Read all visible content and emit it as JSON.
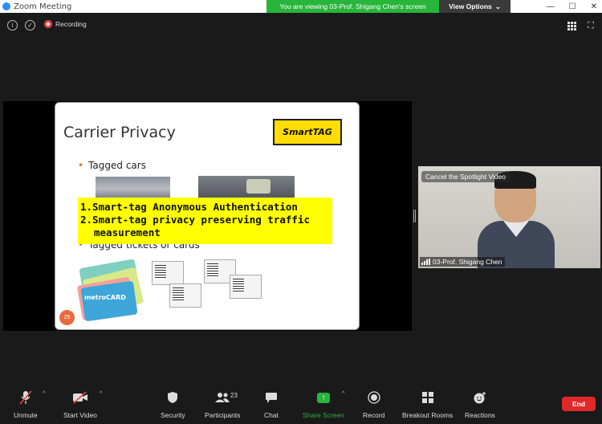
{
  "window": {
    "title": "Zoom Meeting",
    "minimize": "—",
    "maximize": "☐",
    "close": "✕"
  },
  "banner": {
    "message": "You are viewing 03-Prof. Shigang Chen's screen",
    "view_options": "View Options",
    "caret": "⌄"
  },
  "topbar": {
    "info_icon": "i",
    "shield_icon": "✓",
    "recording_label": "Recording",
    "fullscreen_icon": "⛶"
  },
  "slide": {
    "title": "Carrier Privacy",
    "logo_text": "SmartTAG",
    "bullet1": "Tagged cars",
    "bullet2": "Tagged tickets or cards",
    "callout_lines": [
      "1.Smart-tag Anonymous Authentication",
      "2.Smart-tag privacy preserving traffic",
      "measurement"
    ],
    "metrocard_label": "metroCARD",
    "page_number": "25"
  },
  "video": {
    "cancel_spotlight": "Cancel the Spotlight Video",
    "participant_name": "03-Prof. Shigang Chen"
  },
  "toolbar": {
    "unmute": "Unmute",
    "start_video": "Start Video",
    "security": "Security",
    "participants": "Participants",
    "participant_count": "23",
    "chat": "Chat",
    "share_screen": "Share Screen",
    "record": "Record",
    "breakout_rooms": "Breakout Rooms",
    "reactions": "Reactions",
    "end": "End",
    "caret": "^"
  },
  "colors": {
    "share_green": "#27b53b",
    "end_red": "#e02828",
    "callout_yellow": "#ffff00",
    "recording_red": "#e64646"
  }
}
